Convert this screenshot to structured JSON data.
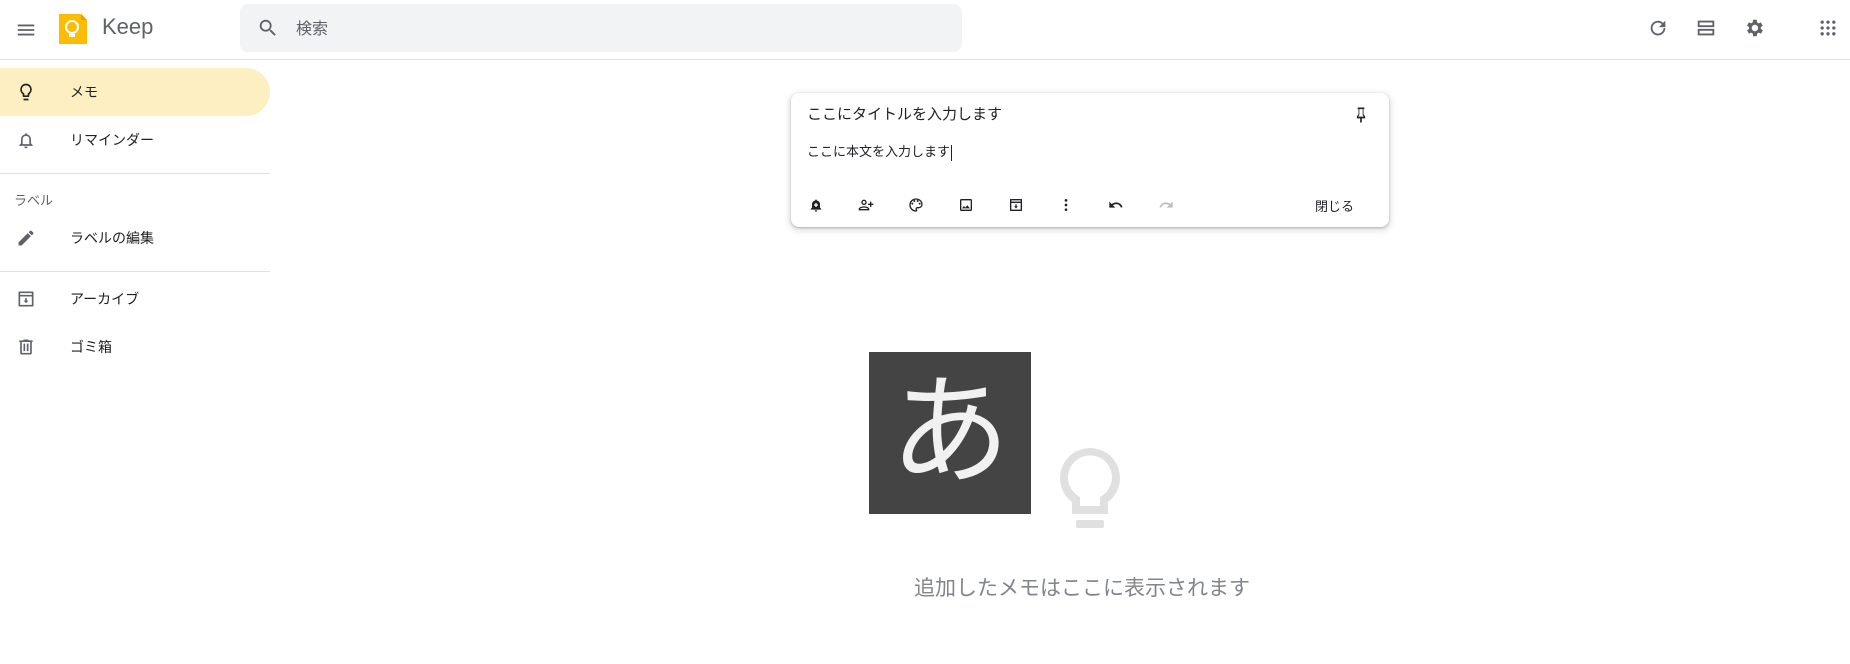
{
  "header": {
    "app_title": "Keep",
    "search_placeholder": "検索"
  },
  "sidebar": {
    "items": [
      {
        "label": "メモ",
        "active": true
      },
      {
        "label": "リマインダー"
      }
    ],
    "section_label": "ラベル",
    "edit_labels": "ラベルの編集",
    "bottom_items": [
      {
        "label": "アーカイブ"
      },
      {
        "label": "ゴミ箱"
      }
    ]
  },
  "note": {
    "title_placeholder": "ここにタイトルを入力します",
    "body_text": "ここに本文を入力します",
    "close_label": "閉じる"
  },
  "empty_state": {
    "ime_char": "あ",
    "message": "追加したメモはここに表示されます"
  },
  "colors": {
    "accent": "#fbbc04",
    "active_nav_bg": "#feefc3",
    "icon": "#5f6368"
  }
}
